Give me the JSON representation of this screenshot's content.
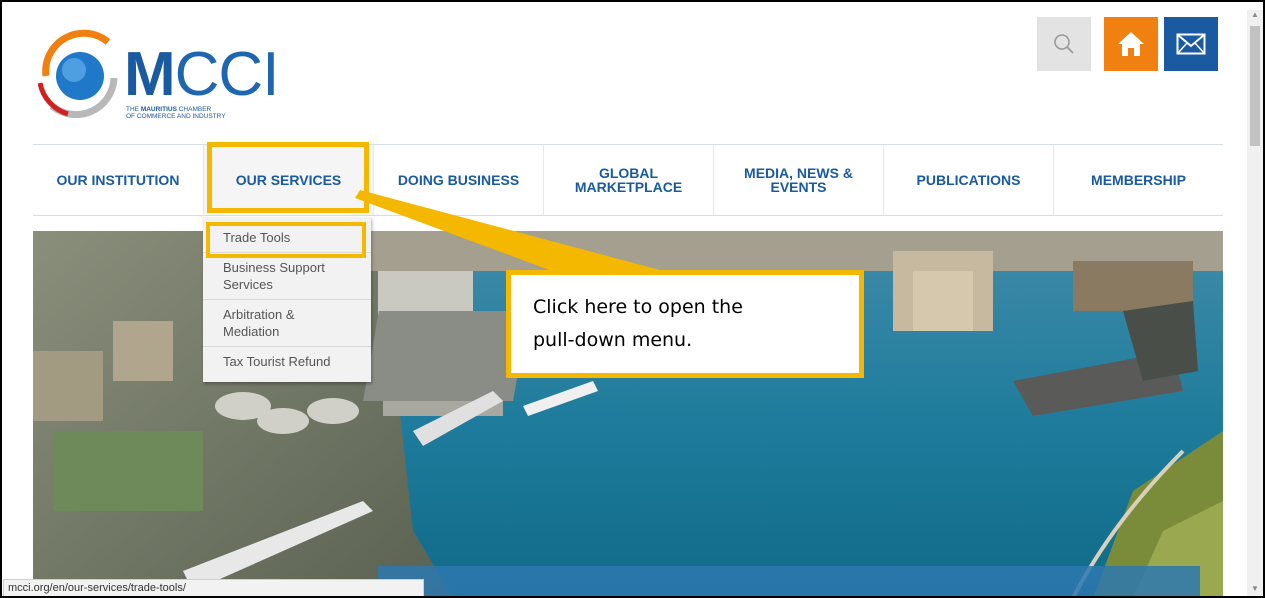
{
  "logo": {
    "word_m": "M",
    "word_cci": "CCI",
    "sub_line1_pre": "THE ",
    "sub_line1_bold": "MAURITIUS",
    "sub_line1_post": " CHAMBER",
    "sub_line2": "OF COMMERCE AND INDUSTRY"
  },
  "header_icons": {
    "search": "search-icon",
    "home": "home-icon",
    "mail": "mail-icon"
  },
  "nav": {
    "items": [
      {
        "label": "OUR INSTITUTION",
        "active": false
      },
      {
        "label": "OUR SERVICES",
        "active": true
      },
      {
        "label": "DOING BUSINESS",
        "active": false
      },
      {
        "label": "GLOBAL MARKETPLACE",
        "active": false
      },
      {
        "label": "MEDIA, NEWS & EVENTS",
        "active": false
      },
      {
        "label": "PUBLICATIONS",
        "active": false
      },
      {
        "label": "MEMBERSHIP",
        "active": false
      }
    ]
  },
  "dropdown": {
    "items": [
      "Trade Tools",
      "Business Support Services",
      "Arbitration & Mediation",
      "Tax Tourist Refund"
    ]
  },
  "callout": {
    "line1": "Click here to open the",
    "line2": "pull-down menu."
  },
  "status_bar": {
    "url": "mcci.org/en/our-services/trade-tools/"
  },
  "colors": {
    "brand_blue": "#1a5aa0",
    "brand_orange": "#f08010",
    "highlight": "#f4b800"
  }
}
